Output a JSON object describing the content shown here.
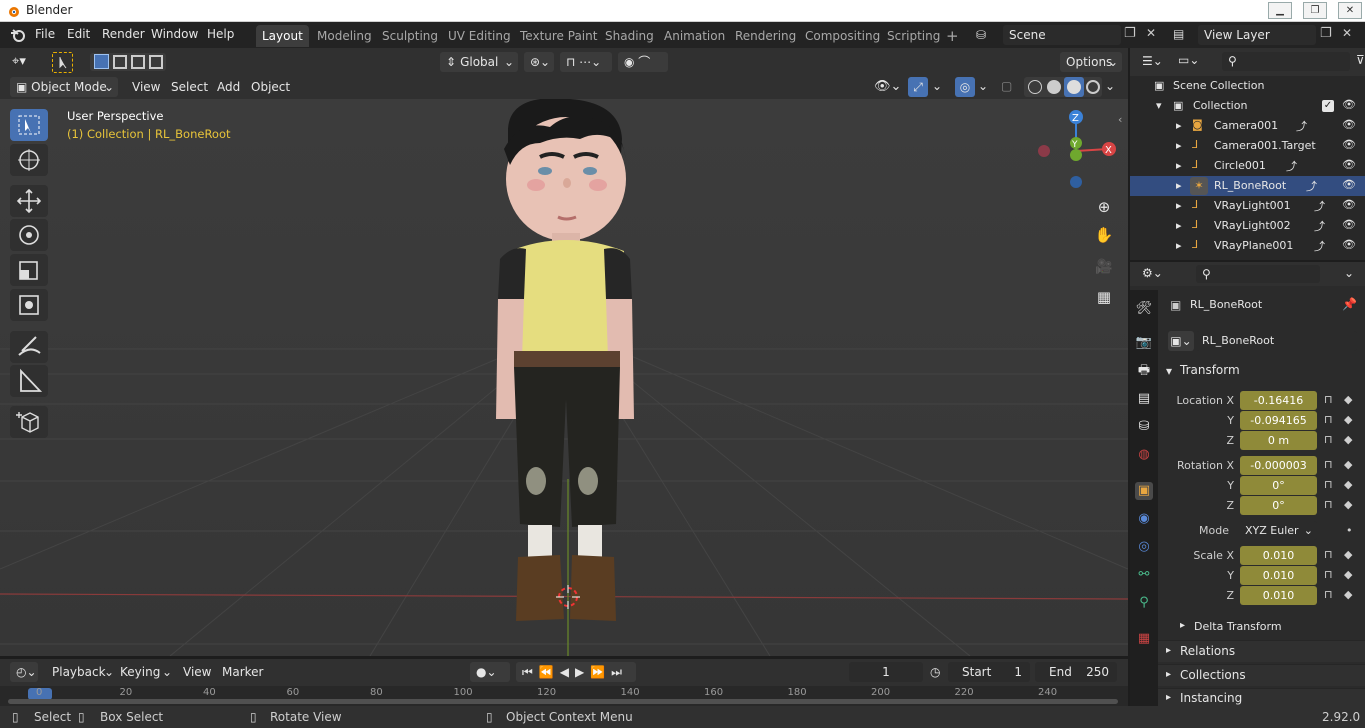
{
  "window": {
    "title": "Blender",
    "minimize": "▁",
    "maximize": "❐",
    "close": "✕"
  },
  "menu": [
    "File",
    "Edit",
    "Render",
    "Window",
    "Help"
  ],
  "workspaces": [
    "Layout",
    "Modeling",
    "Sculpting",
    "UV Editing",
    "Texture Paint",
    "Shading",
    "Animation",
    "Rendering",
    "Compositing",
    "Scripting"
  ],
  "add_tab": "+",
  "scene": {
    "name": "Scene",
    "view_layer": "View Layer"
  },
  "toolheader": {
    "orientation": "Global",
    "options": "Options"
  },
  "viewport_header": {
    "mode": "Object Mode",
    "view": "View",
    "select": "Select",
    "add": "Add",
    "object": "Object"
  },
  "viewport": {
    "perspective": "User Perspective",
    "collection": "(1) Collection | RL_BoneRoot"
  },
  "gizmo": {
    "x": "X",
    "y": "Y",
    "z": "Z"
  },
  "outliner": {
    "root": "Scene Collection",
    "collection": "Collection",
    "items": [
      "Camera001",
      "Camera001.Target",
      "Circle001",
      "RL_BoneRoot",
      "VRayLight001",
      "VRayLight002",
      "VRayPlane001"
    ]
  },
  "properties": {
    "object_name": "RL_BoneRoot",
    "data_name": "RL_BoneRoot",
    "transform_title": "Transform",
    "location": {
      "label": "Location X",
      "x": "-0.16416",
      "y": "-0.094165",
      "z": "0 m"
    },
    "rotation": {
      "label": "Rotation X",
      "x": "-0.000003",
      "y": "0°",
      "z": "0°"
    },
    "mode_label": "Mode",
    "mode_value": "XYZ Euler",
    "scale": {
      "label": "Scale X",
      "x": "0.010",
      "y": "0.010",
      "z": "0.010"
    },
    "y_label": "Y",
    "z_label": "Z",
    "delta": "Delta Transform",
    "sections": [
      "Relations",
      "Collections",
      "Instancing"
    ]
  },
  "timeline": {
    "playback": "Playback",
    "keying": "Keying",
    "view": "View",
    "marker": "Marker",
    "current_frame": "1",
    "start_label": "Start",
    "start": "1",
    "end_label": "End",
    "end": "250",
    "ticks": [
      "0",
      "20",
      "40",
      "60",
      "80",
      "100",
      "120",
      "140",
      "160",
      "180",
      "200",
      "220",
      "240"
    ]
  },
  "status": {
    "select": "Select",
    "box_select": "Box Select",
    "rotate_view": "Rotate View",
    "context_menu": "Object Context Menu",
    "version": "2.92.0"
  },
  "colors": {
    "accent": "#4772b3",
    "field_yellow": "#8f8a39",
    "viewport_bg": "#3c3c3c"
  }
}
